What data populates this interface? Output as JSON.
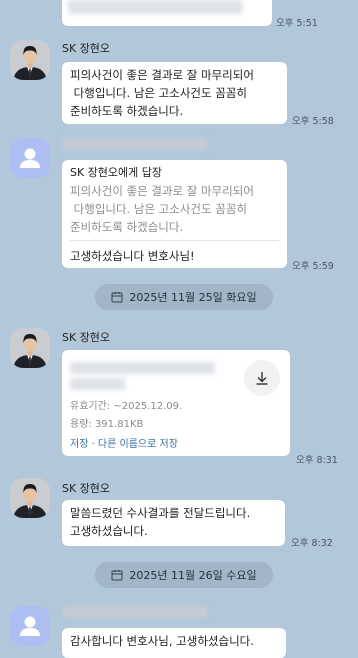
{
  "messages": {
    "m0": {
      "time": "오후 5:51"
    },
    "m1": {
      "sender": "SK 장현오",
      "text_lines": [
        "피의사건이 좋은 결과로 잘 마무리되어",
        " 다행입니다. 남은 고소사건도 꼼꼼히",
        "준비하도록 하겠습니다."
      ],
      "time": "오후 5:58"
    },
    "m2": {
      "reply_label": "SK 장현오에게 답장",
      "quote_lines": [
        "피의사건이 좋은 결과로 잘 마무리되어",
        " 다행입니다. 남은 고소사건도 꼼꼼히",
        "준비하도록 하겠습니다."
      ],
      "text": "고생하셨습니다 변호사님!",
      "time": "오후 5:59"
    },
    "m3": {
      "sender": "SK 장현오",
      "expiry": "유효기간: ~2025.12.09.",
      "size": "용량: 391.81KB",
      "actions": "저장 · 다른 이름으로 저장",
      "time": "오후 8:31"
    },
    "m4": {
      "sender": "SK 장현오",
      "text_lines": [
        "말씀드렸던 수사결과를 전달드립니다.",
        "고생하셨습니다."
      ],
      "time": "오후 8:32"
    },
    "m5": {
      "text": "감사합니다 변호사님, 고생하셨습니다."
    }
  },
  "dates": {
    "d1": "2025년 11월 25일 화요일",
    "d2": "2025년 11월 26일 수요일"
  },
  "icons": {
    "calendar": "calendar-icon",
    "download": "download-icon",
    "default_avatar": "person-icon"
  },
  "colors": {
    "background": "#b2c7da",
    "bubble": "#ffffff",
    "date_pill": "#a3b6c8",
    "link": "#3a6ea5"
  }
}
